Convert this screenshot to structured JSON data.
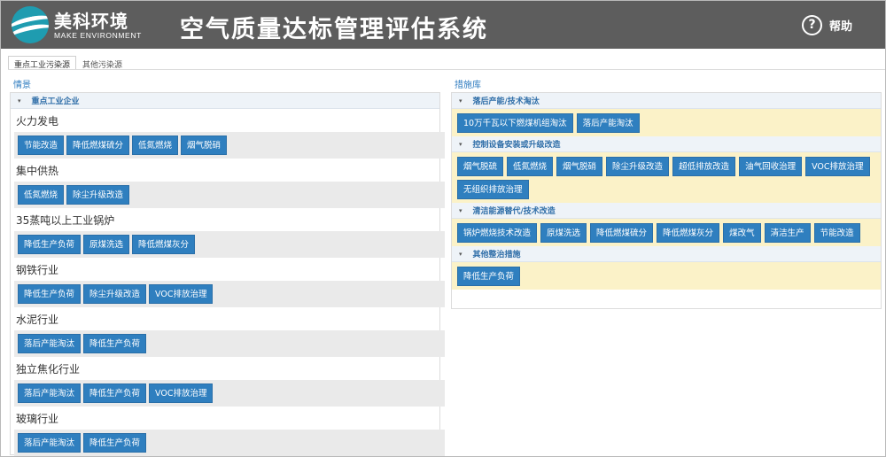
{
  "header": {
    "logo_cn": "美科环境",
    "logo_en": "MAKE ENVIRONMENT",
    "title": "空气质量达标管理评估系统",
    "help_label": "帮助"
  },
  "tabs": [
    {
      "label": "重点工业污染源",
      "active": true
    },
    {
      "label": "其他污染源",
      "active": false
    }
  ],
  "scenario": {
    "title": "情景",
    "group_label": "重点工业企业",
    "industries": [
      {
        "name": "火力发电",
        "buttons": [
          "节能改造",
          "降低燃煤硫分",
          "低氮燃烧",
          "烟气脱硝"
        ]
      },
      {
        "name": "集中供热",
        "buttons": [
          "低氮燃烧",
          "除尘升级改造"
        ]
      },
      {
        "name": "35蒸吨以上工业锅炉",
        "buttons": [
          "降低生产负荷",
          "原煤洗选",
          "降低燃煤灰分"
        ]
      },
      {
        "name": "钢铁行业",
        "buttons": [
          "降低生产负荷",
          "除尘升级改造",
          "VOC排放治理"
        ]
      },
      {
        "name": "水泥行业",
        "buttons": [
          "落后产能淘汰",
          "降低生产负荷"
        ]
      },
      {
        "name": "独立焦化行业",
        "buttons": [
          "落后产能淘汰",
          "降低生产负荷",
          "VOC排放治理"
        ]
      },
      {
        "name": "玻璃行业",
        "buttons": [
          "落后产能淘汰",
          "降低生产负荷"
        ]
      }
    ]
  },
  "measures": {
    "title": "措施库",
    "groups": [
      {
        "label": "落后产能/技术淘汰",
        "buttons": [
          "10万千瓦以下燃煤机组淘汰",
          "落后产能淘汰"
        ]
      },
      {
        "label": "控制设备安装或升级改造",
        "buttons": [
          "烟气脱硫",
          "低氮燃烧",
          "烟气脱硝",
          "除尘升级改造",
          "超低排放改造",
          "油气回收治理",
          "VOC排放治理",
          "无组织排放治理"
        ]
      },
      {
        "label": "清洁能源替代/技术改造",
        "buttons": [
          "锅炉燃烧技术改造",
          "原煤洗选",
          "降低燃煤硫分",
          "降低燃煤灰分",
          "煤改气",
          "清洁生产",
          "节能改造"
        ]
      },
      {
        "label": "其他整治措施",
        "buttons": [
          "降低生产负荷"
        ]
      }
    ]
  },
  "colors": {
    "header_bg": "#5d5d5d",
    "button_blue": "#2f7fbf",
    "measure_bg": "#fbf2c8",
    "accent_text": "#2f7cc0"
  }
}
